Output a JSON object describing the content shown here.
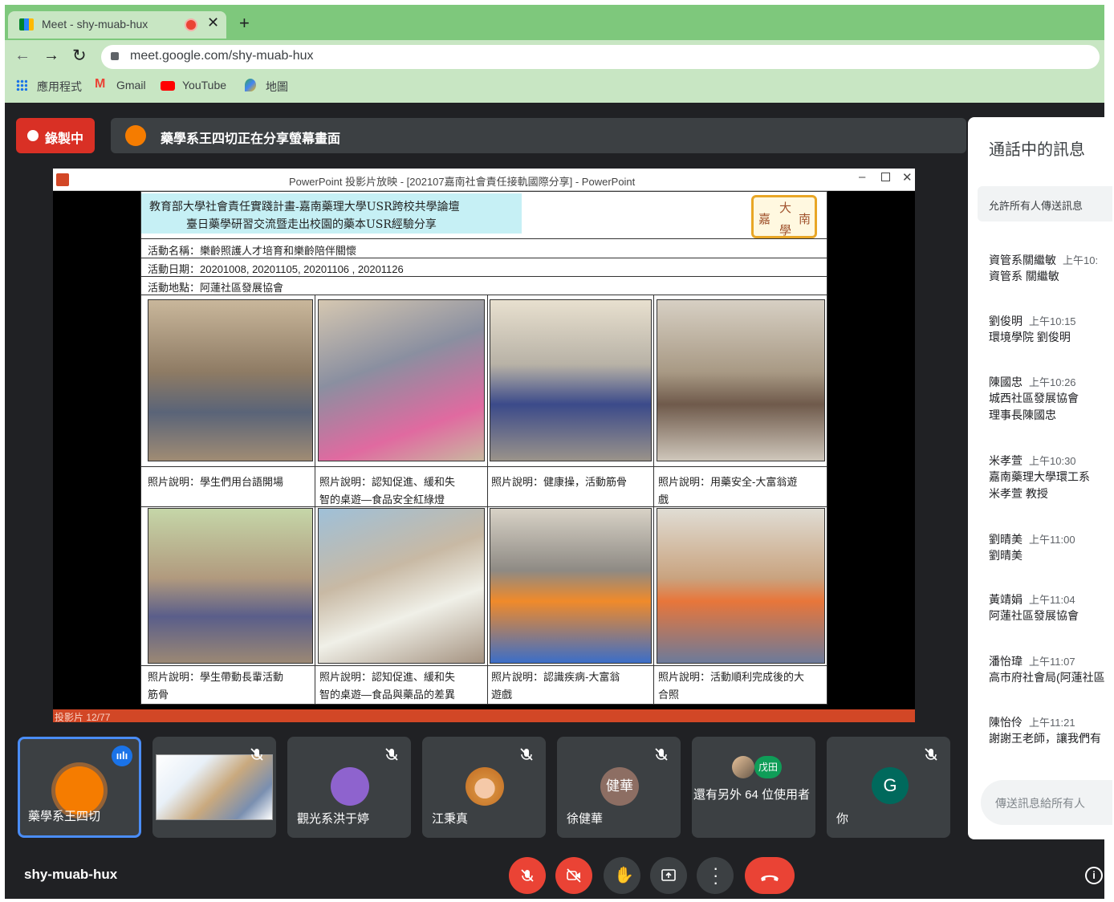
{
  "browser": {
    "tab_title": "Meet - shy-muab-hux",
    "url": "meet.google.com/shy-muab-hux",
    "bookmarks": [
      "應用程式",
      "Gmail",
      "YouTube",
      "地圖"
    ]
  },
  "meet": {
    "recording_label": "錄製中",
    "sharing_banner": "藥學系王四切正在分享螢幕畫面",
    "meeting_code": "shy-muab-hux"
  },
  "presentation": {
    "window_title": "PowerPoint 投影片放映 - [202107嘉南社會責任接軌國際分享] - PowerPoint",
    "slide_counter": "投影片 12/77",
    "title_line1": "教育部大學社會責任實踐計畫-嘉南藥理大學USR跨校共學論壇",
    "title_line2": "臺日藥學研習交流暨走出校園的藥本USR經驗分享",
    "logo_chars": [
      "大",
      "南",
      "嘉",
      "學"
    ],
    "row_name": "活動名稱：樂齡照護人才培育和樂齡陪伴關懷",
    "row_date": "活動日期：20201008, 20201105, 20201106 , 20201126",
    "row_place": "活動地點：阿蓮社區發展協會",
    "captions": [
      [
        "照片說明：學生們用台語開場",
        ""
      ],
      [
        "照片說明：認知促進、緩和失",
        "智的桌遊—食品安全紅綠燈"
      ],
      [
        "照片說明：健康操，活動筋骨",
        ""
      ],
      [
        "照片說明：用藥安全-大富翁遊",
        "戲"
      ],
      [
        "照片說明：學生帶動長輩活動",
        "筋骨"
      ],
      [
        "照片說明：認知促進、緩和失",
        "智的桌遊—食品與藥品的差異"
      ],
      [
        "照片說明：認識疾病-大富翁",
        "遊戲"
      ],
      [
        "照片說明：活動順利完成後的大",
        "合照"
      ]
    ]
  },
  "participants": [
    {
      "name": "藥學系王四切",
      "initials": "",
      "speaking": true
    },
    {
      "name": "",
      "initials": "",
      "speaking": false
    },
    {
      "name": "觀光系洪于婷",
      "initials": "",
      "speaking": false
    },
    {
      "name": "江秉真",
      "initials": "",
      "speaking": false
    },
    {
      "name": "徐健華",
      "initials": "健華",
      "speaking": false
    },
    {
      "name": "還有另外 64 位使用者",
      "initials": "戊田",
      "speaking": false
    },
    {
      "name": "你",
      "initials": "G",
      "speaking": false
    }
  ],
  "chat": {
    "title": "通話中的訊息",
    "allow_label": "允許所有人傳送訊息",
    "input_placeholder": "傳送訊息給所有人",
    "messages": [
      {
        "name": "資管系關繼敏",
        "time": "上午10:",
        "lines": [
          "資管系 關繼敏"
        ]
      },
      {
        "name": "劉俊明",
        "time": "上午10:15",
        "lines": [
          "環境學院 劉俊明"
        ]
      },
      {
        "name": "陳國忠",
        "time": "上午10:26",
        "lines": [
          "城西社區發展協會",
          "理事長陳國忠"
        ]
      },
      {
        "name": "米孝萱",
        "time": "上午10:30",
        "lines": [
          "嘉南藥理大學環工系",
          "米孝萱 教授"
        ]
      },
      {
        "name": "劉晴美",
        "time": "上午11:00",
        "lines": [
          "劉晴美"
        ]
      },
      {
        "name": "黃靖娟",
        "time": "上午11:04",
        "lines": [
          "阿蓮社區發展協會"
        ]
      },
      {
        "name": "潘怡瑋",
        "time": "上午11:07",
        "lines": [
          "高市府社會局(阿蓮社區"
        ]
      },
      {
        "name": "陳怡伶",
        "time": "上午11:21",
        "lines": [
          "謝謝王老師，讓我們有"
        ]
      }
    ]
  },
  "colors": {
    "accent_blue": "#1a73e8",
    "danger_red": "#ea4335",
    "meet_bg": "#202124"
  }
}
